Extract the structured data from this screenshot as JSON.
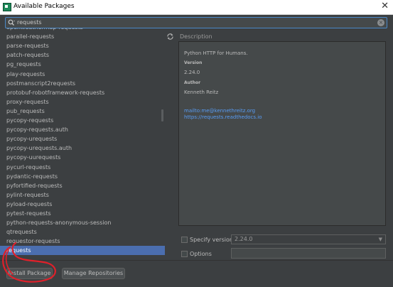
{
  "window": {
    "title": "Available Packages",
    "close_glyph": "✕"
  },
  "search": {
    "value": "requests",
    "icon": "search-icon",
    "clear_glyph": "×"
  },
  "packages": [
    "openweathermap-requests",
    "parallel-requests",
    "parse-requests",
    "patch-requests",
    "pg_requests",
    "play-requests",
    "postmanscript2requests",
    "protobuf-robotframework-requests",
    "proxy-requests",
    "pub_requests",
    "pycopy-requests",
    "pycopy-requests.auth",
    "pycopy-urequests",
    "pycopy-urequests.auth",
    "pycopy-uurequests",
    "pycurl-requests",
    "pydantic-requests",
    "pyfortified-requests",
    "pylint-requests",
    "pyload-requests",
    "pytest-requests",
    "python-requests-anonymous-session",
    "qtrequests",
    "requestor-requests",
    "requests"
  ],
  "selected_package": "requests",
  "description": {
    "label": "Description",
    "summary": "Python HTTP for Humans.",
    "version_heading": "Version",
    "version": "2.24.0",
    "author_heading": "Author",
    "author": "Kenneth Reitz",
    "email": "mailto:me@kennethreitz.org",
    "url": "https://requests.readthedocs.io"
  },
  "options": {
    "specify_version_label": "Specify version",
    "specify_version_checked": false,
    "version_value": "2.24.0",
    "options_label": "Options",
    "options_checked": false,
    "options_value": ""
  },
  "buttons": {
    "install": "Install Package",
    "manage": "Manage Repositories"
  },
  "colors": {
    "background": "#3c3f41",
    "panel": "#45494a",
    "selection": "#4b6eaf",
    "link": "#589df6",
    "focus_border": "#4a88c7",
    "annotation": "#e0202a"
  }
}
